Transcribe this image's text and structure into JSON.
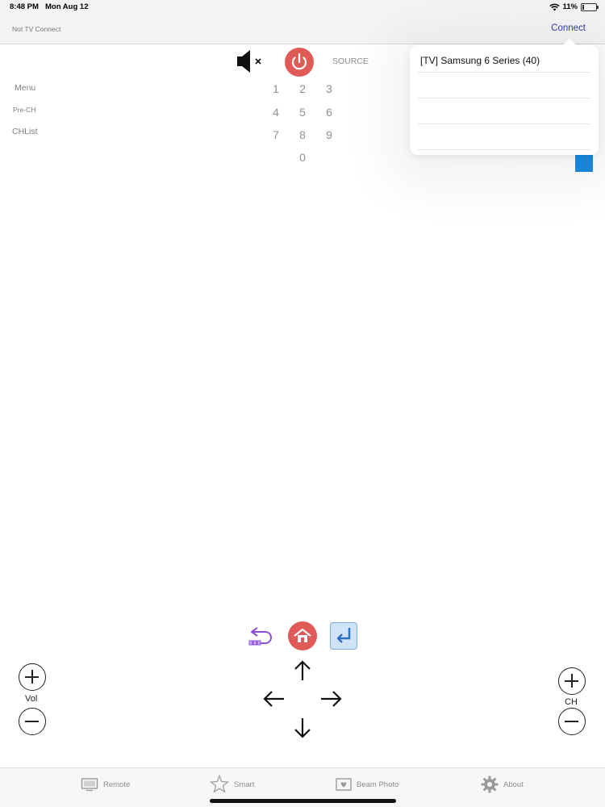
{
  "status_bar": {
    "time": "8:48 PM",
    "date": "Mon Aug 12",
    "battery_percent": "11%",
    "battery_level": 0.11
  },
  "nav": {
    "title": "Not TV Connect",
    "connect_label": "Connect"
  },
  "remote": {
    "source_label": "SOURCE",
    "menu_label": "Menu",
    "prech_label": "Pre-CH",
    "chlist_label": "CHList",
    "numbers": [
      "1",
      "2",
      "3",
      "4",
      "5",
      "6",
      "7",
      "8",
      "9",
      "0"
    ],
    "vol_label": "Vol",
    "ch_label": "CH"
  },
  "popover": {
    "devices": [
      "[TV] Samsung 6 Series (40)",
      "",
      "",
      ""
    ]
  },
  "tabs": [
    {
      "label": "Remote",
      "icon": "tv-icon"
    },
    {
      "label": "Smart",
      "icon": "star-icon"
    },
    {
      "label": "Beam Photo",
      "icon": "photo-icon"
    },
    {
      "label": "About",
      "icon": "gear-icon"
    }
  ],
  "colors": {
    "accent": "#2f3da6",
    "power": "#e05a58",
    "blue_square": "#1a8be0",
    "home": "#e05a58",
    "back": "#8a4fd6",
    "enter": "#3f86d6"
  }
}
